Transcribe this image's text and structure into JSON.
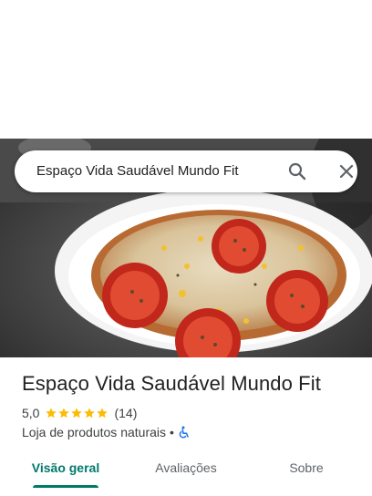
{
  "search": {
    "query": "Espaço Vida Saudável Mundo Fit"
  },
  "place": {
    "name": "Espaço Vida Saudável Mundo Fit",
    "rating": "5,0",
    "stars": 5,
    "reviews": "(14)",
    "category": "Loja de produtos naturais",
    "separator": "•"
  },
  "tabs": [
    {
      "label": "Visão geral",
      "active": true
    },
    {
      "label": "Avaliações",
      "active": false
    },
    {
      "label": "Sobre",
      "active": false
    }
  ],
  "icons": {
    "search": "search-icon",
    "close": "close-icon",
    "star": "star-icon",
    "accessibility": "wheelchair-icon"
  },
  "colors": {
    "accent": "#00796b",
    "star": "#fbbc04",
    "text_primary": "#202124",
    "text_secondary": "#3c4043",
    "accessibility": "#1a73e8"
  }
}
